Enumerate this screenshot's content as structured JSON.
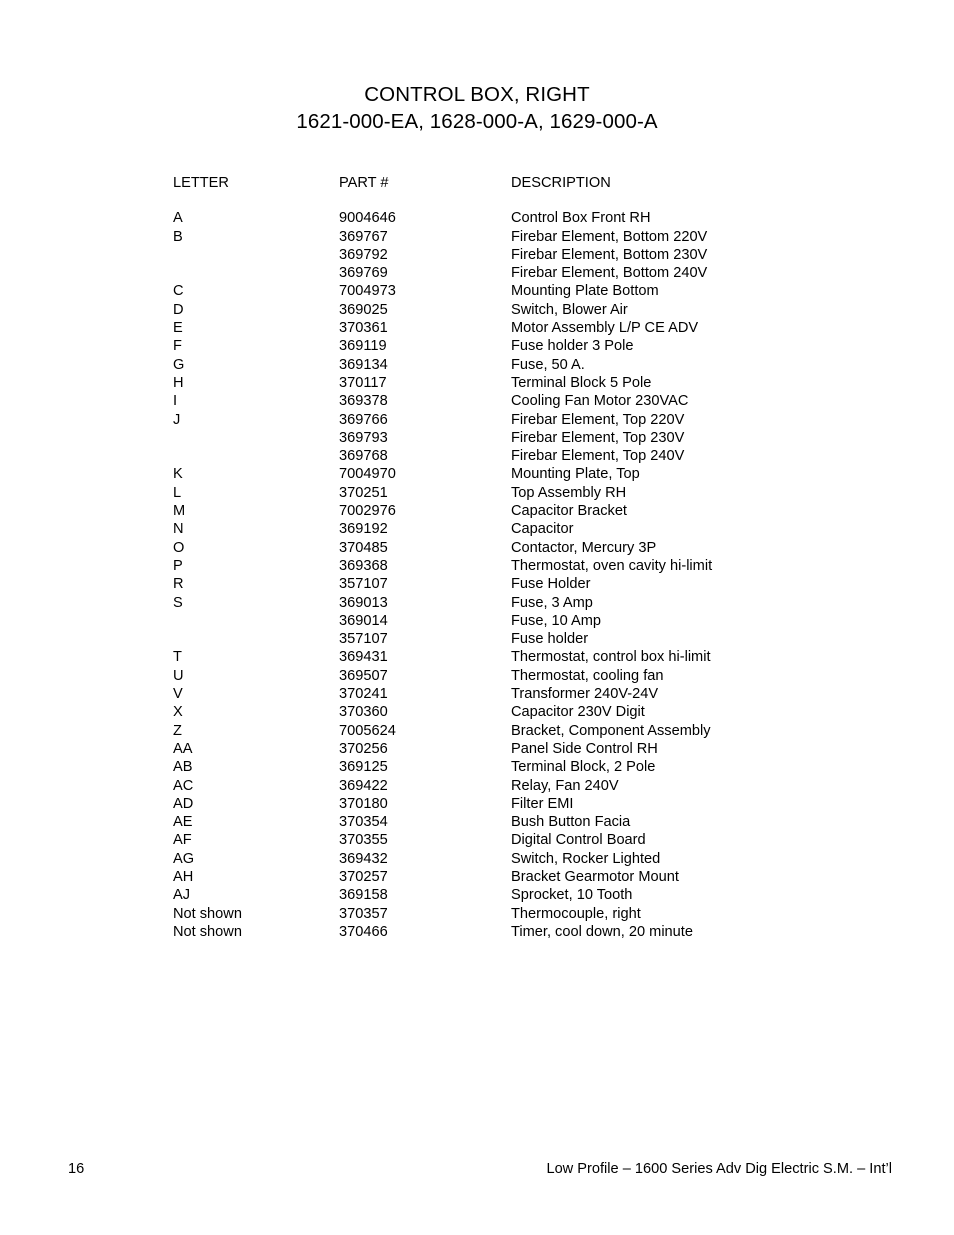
{
  "title": {
    "line1": "CONTROL BOX, RIGHT",
    "line2": "1621-000-EA, 1628-000-A, 1629-000-A"
  },
  "table": {
    "headers": {
      "letter": "LETTER",
      "part": "PART #",
      "description": "DESCRIPTION"
    },
    "rows": [
      {
        "letter": "A",
        "part": "9004646",
        "description": "Control Box Front RH"
      },
      {
        "letter": "B",
        "part": "369767",
        "description": "Firebar Element, Bottom 220V"
      },
      {
        "letter": "",
        "part": "369792",
        "description": "Firebar Element, Bottom 230V"
      },
      {
        "letter": "",
        "part": "369769",
        "description": "Firebar Element, Bottom 240V"
      },
      {
        "letter": "C",
        "part": "7004973",
        "description": "Mounting Plate Bottom"
      },
      {
        "letter": "D",
        "part": "369025",
        "description": "Switch, Blower Air"
      },
      {
        "letter": "E",
        "part": "370361",
        "description": "Motor Assembly L/P CE ADV"
      },
      {
        "letter": "F",
        "part": "369119",
        "description": "Fuse holder 3 Pole"
      },
      {
        "letter": "G",
        "part": "369134",
        "description": "Fuse, 50 A."
      },
      {
        "letter": "H",
        "part": "370117",
        "description": "Terminal Block 5 Pole"
      },
      {
        "letter": "I",
        "part": "369378",
        "description": "Cooling Fan Motor 230VAC"
      },
      {
        "letter": "J",
        "part": "369766",
        "description": "Firebar Element, Top 220V"
      },
      {
        "letter": "",
        "part": "369793",
        "description": "Firebar Element, Top 230V"
      },
      {
        "letter": "",
        "part": "369768",
        "description": "Firebar Element, Top 240V"
      },
      {
        "letter": "K",
        "part": "7004970",
        "description": "Mounting Plate, Top"
      },
      {
        "letter": "L",
        "part": "370251",
        "description": "Top Assembly RH"
      },
      {
        "letter": "M",
        "part": "7002976",
        "description": "Capacitor Bracket"
      },
      {
        "letter": "N",
        "part": "369192",
        "description": "Capacitor"
      },
      {
        "letter": "O",
        "part": "370485",
        "description": "Contactor, Mercury 3P"
      },
      {
        "letter": "P",
        "part": "369368",
        "description": "Thermostat, oven cavity hi-limit"
      },
      {
        "letter": "R",
        "part": "357107",
        "description": "Fuse Holder"
      },
      {
        "letter": "S",
        "part": "369013",
        "description": "Fuse, 3 Amp"
      },
      {
        "letter": "",
        "part": "369014",
        "description": "Fuse, 10 Amp"
      },
      {
        "letter": "",
        "part": "357107",
        "description": "Fuse holder"
      },
      {
        "letter": "T",
        "part": "369431",
        "description": "Thermostat, control box hi-limit"
      },
      {
        "letter": "U",
        "part": "369507",
        "description": "Thermostat, cooling fan"
      },
      {
        "letter": "V",
        "part": "370241",
        "description": "Transformer 240V-24V"
      },
      {
        "letter": "X",
        "part": "370360",
        "description": "Capacitor 230V Digit"
      },
      {
        "letter": "Z",
        "part": "7005624",
        "description": "Bracket, Component Assembly"
      },
      {
        "letter": "AA",
        "part": "370256",
        "description": "Panel Side Control RH"
      },
      {
        "letter": "AB",
        "part": "369125",
        "description": "Terminal Block, 2 Pole"
      },
      {
        "letter": "AC",
        "part": "369422",
        "description": "Relay, Fan 240V"
      },
      {
        "letter": "AD",
        "part": "370180",
        "description": "Filter EMI"
      },
      {
        "letter": "AE",
        "part": "370354",
        "description": "Bush Button Facia"
      },
      {
        "letter": "AF",
        "part": "370355",
        "description": "Digital Control Board"
      },
      {
        "letter": "AG",
        "part": "369432",
        "description": "Switch, Rocker Lighted"
      },
      {
        "letter": "AH",
        "part": "370257",
        "description": "Bracket Gearmotor Mount"
      },
      {
        "letter": "AJ",
        "part": "369158",
        "description": "Sprocket, 10 Tooth"
      },
      {
        "letter": "Not shown",
        "part": "370357",
        "description": "Thermocouple, right"
      },
      {
        "letter": "Not shown",
        "part": "370466",
        "description": "Timer, cool down, 20 minute"
      }
    ]
  },
  "footer": {
    "page_number": "16",
    "document_title": "Low Profile – 1600 Series Adv Dig Electric S.M. – Int’l"
  }
}
